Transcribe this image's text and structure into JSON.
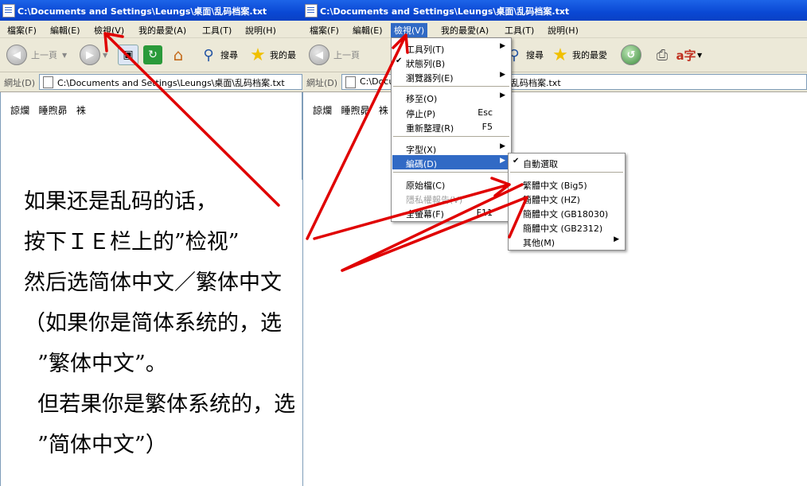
{
  "left_window": {
    "title": "C:\\Documents and Settings\\Leungs\\桌面\\乱码档案.txt",
    "menu": [
      "檔案(F)",
      "編輯(E)",
      "檢視(V)",
      "我的最愛(A)",
      "工具(T)",
      "說明(H)"
    ],
    "toolbar": {
      "back": "上一頁",
      "search": "搜尋",
      "favorites": "我的最"
    },
    "address_label": "網址(D)",
    "address_value": "C:\\Documents and Settings\\Leungs\\桌面\\乱码档案.txt",
    "content_text": "諒爛   睡煦昴   袾"
  },
  "right_window": {
    "title": "C:\\Documents and Settings\\Leungs\\桌面\\乱码档案.txt",
    "menu": [
      "檔案(F)",
      "編輯(E)",
      "檢視(V)",
      "我的最愛(A)",
      "工具(T)",
      "說明(H)"
    ],
    "active_menu": "檢視(V)",
    "toolbar": {
      "back": "上一頁",
      "search": "搜尋",
      "favorites": "我的最愛"
    },
    "address_label": "網址(D)",
    "address_value": "C:\\Docu",
    "address_value_tail": "乱码档案.txt",
    "content_text": "諒爛   睡煦昴   袾"
  },
  "view_menu": [
    {
      "label": "工具列(T)",
      "arrow": true
    },
    {
      "label": "狀態列(B)",
      "checked": true
    },
    {
      "label": "瀏覽器列(E)",
      "arrow": true
    },
    {
      "label": "移至(O)",
      "arrow": true
    },
    {
      "label": "停止(P)",
      "shortcut": "Esc"
    },
    {
      "label": "重新整理(R)",
      "shortcut": "F5"
    },
    {
      "label": "字型(X)",
      "arrow": true
    },
    {
      "label": "編碼(D)",
      "arrow": true,
      "highlighted": true
    },
    {
      "label": "原始檔(C)"
    },
    {
      "label": "隱私權報告(V)",
      "disabled": true
    },
    {
      "label": "全螢幕(F)",
      "shortcut": "F11"
    }
  ],
  "encoding_menu": [
    {
      "label": "自動選取",
      "checked": true
    },
    {
      "label": "繁體中文 (Big5)"
    },
    {
      "label": "簡體中文 (HZ)"
    },
    {
      "label": "簡體中文 (GB18030)"
    },
    {
      "label": "簡體中文 (GB2312)"
    },
    {
      "label": "其他(M)",
      "arrow": true
    }
  ],
  "instructions": [
    "如果还是乱码的话，",
    "按下ＩＥ栏上的”检视”",
    "然后选简体中文／繁体中文",
    "（如果你是简体系统的，选",
    "  ”繁体中文”。",
    "  但若果你是繁体系统的，选",
    "  ”简体中文”）"
  ],
  "colors": {
    "titlebar": "#0a48d4",
    "menu_highlight": "#316ac5",
    "arrow": "#e00000",
    "chrome": "#ece9d8"
  }
}
